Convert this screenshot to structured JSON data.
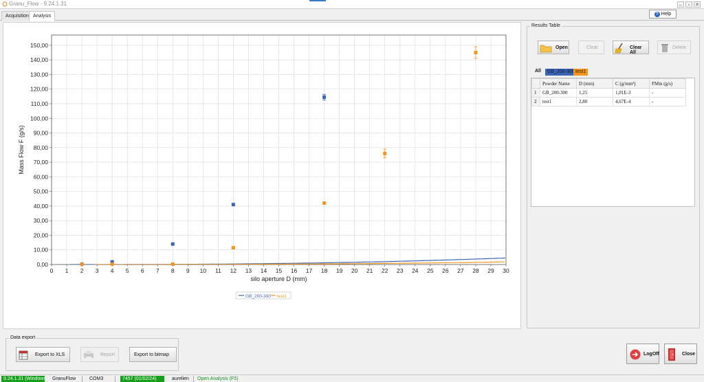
{
  "window": {
    "title": "Granu_Flow - 9.24.1.31"
  },
  "tabs": [
    "Acquisition",
    "Analysis"
  ],
  "help_label": "Help",
  "results": {
    "legend": "Results Table",
    "buttons": {
      "open": "Open",
      "clear": "Clear",
      "clear_all": "Clear All",
      "delete": "Delete"
    },
    "filter_all": "All",
    "pills": [
      {
        "label": "GB_200-300",
        "color": "#3c64b4"
      },
      {
        "label": "test1",
        "color": "#f0961e"
      }
    ],
    "columns": [
      "",
      "Powder Name",
      "D (mm)",
      "C (g/mm³)",
      "FMin (g/s)"
    ],
    "rows": [
      [
        "1",
        "GB_200-300",
        "1,25",
        "1,01E-3",
        "-"
      ],
      [
        "2",
        "test1",
        "2,80",
        "4,67E-4",
        "-"
      ]
    ]
  },
  "export": {
    "legend": "Data export",
    "xls": "Export to XLS",
    "report": "Report",
    "bitmap": "Export to bitmap"
  },
  "actions": {
    "logoff": "LogOff",
    "close": "Close"
  },
  "status": {
    "version": "9.24.1.31 (Windows)",
    "app": "GranuFlow",
    "port": "COM3",
    "serial": "7457 (01/02/24)",
    "user": "aurelien",
    "mode": "Open Analysis (F5)"
  },
  "colors": {
    "series1": "#3c64b4",
    "series2": "#f0961e",
    "status_green": "#14a019"
  },
  "chart_data": {
    "type": "scatter",
    "xlabel": "silo aperture D (mm)",
    "ylabel": "Mass Flow F (g/s)",
    "xlim": [
      0,
      30
    ],
    "ylim": [
      0,
      157
    ],
    "xticks": [
      "0",
      "1",
      "2",
      "3",
      "4",
      "5",
      "6",
      "7",
      "8",
      "9",
      "10",
      "11",
      "12",
      "13",
      "14",
      "15",
      "16",
      "17",
      "18",
      "19",
      "20",
      "21",
      "22",
      "23",
      "24",
      "25",
      "26",
      "27",
      "28",
      "29",
      "30"
    ],
    "yticks": [
      "0,00",
      "10,00",
      "20,00",
      "30,00",
      "40,00",
      "50,00",
      "60,00",
      "70,00",
      "80,00",
      "90,00",
      "100,00",
      "110,00",
      "120,00",
      "130,00",
      "140,00",
      "150,00"
    ],
    "grid": true,
    "legend_position": "bottom",
    "series": [
      {
        "name": "GB_200-300",
        "color": "#3c64b4",
        "points": [
          {
            "x": 2,
            "y": 0.3
          },
          {
            "x": 4,
            "y": 1.8
          },
          {
            "x": 8,
            "y": 14
          },
          {
            "x": 12,
            "y": 41
          },
          {
            "x": 18,
            "y": 114.5,
            "err": 2
          }
        ],
        "fit": {
          "D0": 1.25,
          "C": 0.00101
        }
      },
      {
        "name": "test1",
        "color": "#f0961e",
        "points": [
          {
            "x": 2,
            "y": 0.1
          },
          {
            "x": 4,
            "y": 0.3
          },
          {
            "x": 8,
            "y": 0.3
          },
          {
            "x": 12,
            "y": 11.5
          },
          {
            "x": 18,
            "y": 42
          },
          {
            "x": 22,
            "y": 76,
            "err": 3
          },
          {
            "x": 28,
            "y": 145,
            "err": 4
          }
        ],
        "fit": {
          "D0": 2.8,
          "C": 0.000467
        }
      }
    ]
  }
}
